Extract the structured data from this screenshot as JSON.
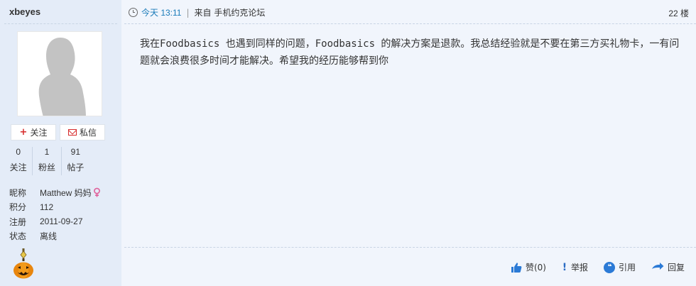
{
  "user": {
    "name": "xbeyes",
    "follow_label": "关注",
    "message_label": "私信",
    "stats": [
      {
        "num": "0",
        "label": "关注"
      },
      {
        "num": "1",
        "label": "粉丝"
      },
      {
        "num": "91",
        "label": "帖子"
      }
    ],
    "info": [
      {
        "key": "昵称",
        "value": "Matthew 妈妈",
        "gender_icon": "female-icon"
      },
      {
        "key": "积分",
        "value": "112"
      },
      {
        "key": "注册",
        "value": "2011-09-27"
      },
      {
        "key": "状态",
        "value": "离线"
      }
    ],
    "medal_icon": "pumpkin-medal-icon"
  },
  "post": {
    "time": "今天 13:11",
    "separator": "|",
    "source": "来自 手机约克论坛",
    "floor": "22 楼",
    "content": "我在Foodbasics 也遇到同样的问题，Foodbasics 的解决方案是退款。我总结经验就是不要在第三方买礼物卡，一有问题就会浪费很多时间才能解决。希望我的经历能够帮到你"
  },
  "actions": {
    "like": "赞(0)",
    "report": "举报",
    "quote": "引用",
    "reply": "回复"
  },
  "colors": {
    "sidebar_bg": "#e4ecf8",
    "main_bg": "#f1f5fc",
    "time_link": "#1a7bb9",
    "accent_red": "#d62b2b",
    "icon_blue": "#2b7ad6"
  }
}
